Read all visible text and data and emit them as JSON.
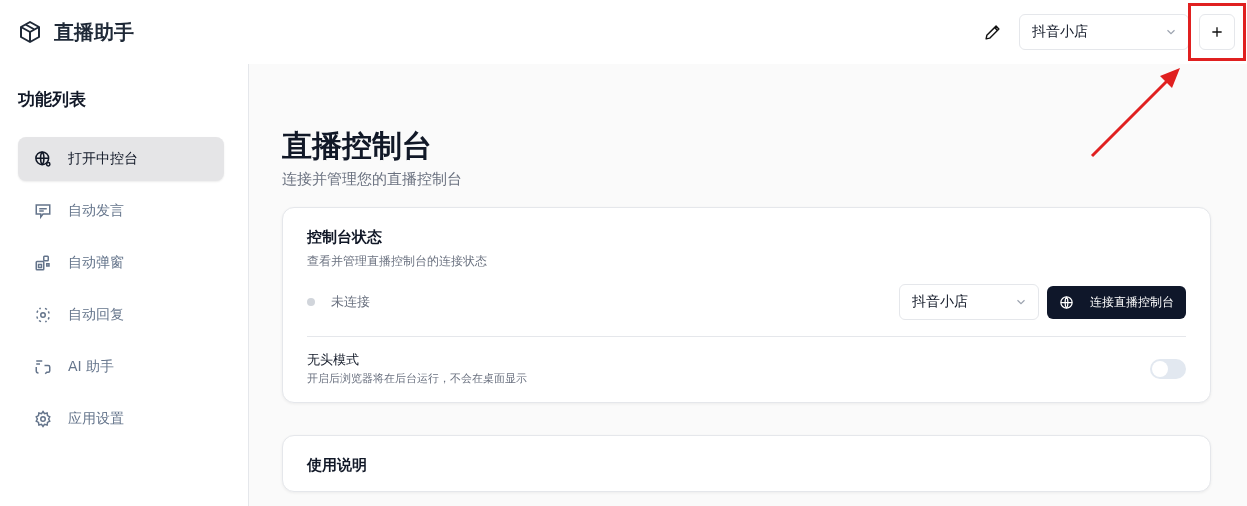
{
  "app": {
    "title": "直播助手"
  },
  "header": {
    "platform_select": {
      "value": "抖音小店"
    }
  },
  "sidebar": {
    "title": "功能列表",
    "items": [
      {
        "label": "打开中控台",
        "kind": "console",
        "selected": true
      },
      {
        "label": "自动发言",
        "kind": "message",
        "selected": false
      },
      {
        "label": "自动弹窗",
        "kind": "popup",
        "selected": false
      },
      {
        "label": "自动回复",
        "kind": "reply",
        "selected": false
      },
      {
        "label": "AI 助手",
        "kind": "assistant",
        "selected": false
      },
      {
        "label": "应用设置",
        "kind": "settings",
        "selected": false
      }
    ]
  },
  "page": {
    "title": "直播控制台",
    "subtitle": "连接并管理您的直播控制台"
  },
  "status_card": {
    "title": "控制台状态",
    "description": "查看并管理直播控制台的连接状态",
    "status": {
      "connected": false,
      "label": "未连接"
    },
    "platform_select": {
      "value": "抖音小店"
    },
    "connect_button": "连接直播控制台",
    "headless": {
      "label": "无头模式",
      "description": "开启后浏览器将在后台运行，不会在桌面显示",
      "on": false
    }
  },
  "guide_card": {
    "title": "使用说明"
  }
}
